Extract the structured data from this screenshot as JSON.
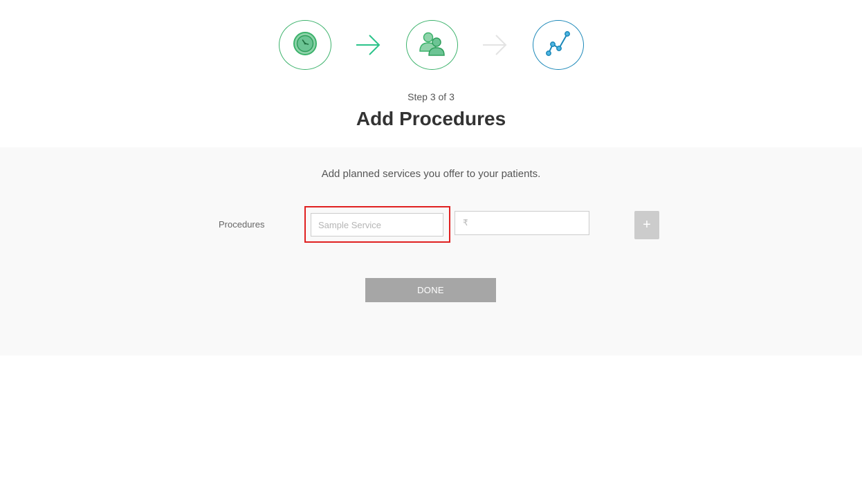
{
  "wizard": {
    "steps": [
      {
        "icon": "clock-icon",
        "status": "completed"
      },
      {
        "icon": "users-icon",
        "status": "completed"
      },
      {
        "icon": "line-graph-icon",
        "status": "active"
      }
    ],
    "step_text": "Step 3 of 3",
    "title": "Add Procedures"
  },
  "form": {
    "description": "Add planned services you offer to your patients.",
    "procedures_label": "Procedures",
    "service_placeholder": "Sample Service",
    "service_value": "",
    "currency_symbol": "₹",
    "price_value": "",
    "add_label": "+",
    "done_label": "DONE"
  },
  "colors": {
    "completed": "#3bb26b",
    "active": "#1a87b8",
    "arrow_done": "#2cc38a",
    "arrow_pending": "#e3e3e3",
    "panel_background": "#f9f9f9",
    "highlight": "#e02020",
    "done_button": "#a6a6a6",
    "add_button": "#cccccc"
  }
}
